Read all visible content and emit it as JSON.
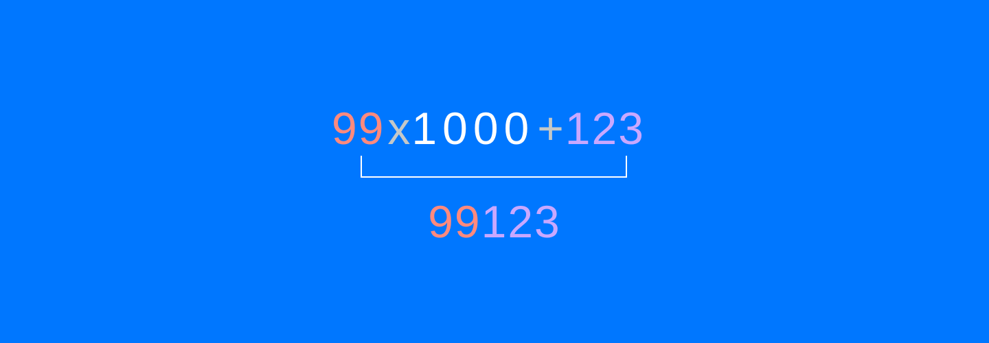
{
  "equation": {
    "multiplicand": "99",
    "times_op": "x",
    "multiplier": "1000",
    "plus_op": "+",
    "addend": "123"
  },
  "result": {
    "high_part": "99",
    "low_part": "123"
  },
  "colors": {
    "background": "#0077ff",
    "multiplicand": "#ff8a7e",
    "operator": "#c4c8c8",
    "multiplier": "#ffffff",
    "addend": "#c9a8ff",
    "bracket": "#ffffff"
  }
}
